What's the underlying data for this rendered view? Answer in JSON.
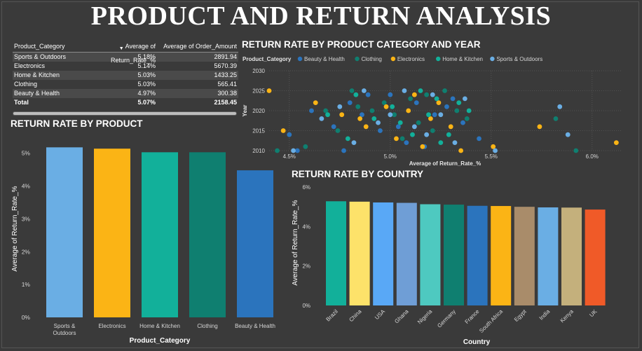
{
  "page": {
    "title": "PRODUCT AND RETURN ANALYSIS"
  },
  "table": {
    "headers": [
      "Product_Category",
      "Average of Return_Rate_%",
      "Average of Order_Amount"
    ],
    "rows": [
      [
        "Sports & Outdoors",
        "5.18%",
        "2891.94"
      ],
      [
        "Electronics",
        "5.14%",
        "5670.39"
      ],
      [
        "Home & Kitchen",
        "5.03%",
        "1433.25"
      ],
      [
        "Clothing",
        "5.03%",
        "565.41"
      ],
      [
        "Beauty & Health",
        "4.97%",
        "300.38"
      ]
    ],
    "total": [
      "Total",
      "5.07%",
      "2158.45"
    ]
  },
  "colors": {
    "Sports & Outdoors": "#6aaee4",
    "Electronics": "#fbb415",
    "Home & Kitchen": "#12b09a",
    "Clothing": "#0f7f70",
    "Beauty & Health": "#2b74bd"
  },
  "chart_data": [
    {
      "type": "bar",
      "title": "RETURN RATE BY PRODUCT",
      "xlabel": "Product_Category",
      "ylabel": "Average of Return_Rate_%",
      "categories": [
        "Sports & Outdoors",
        "Electronics",
        "Home & Kitchen",
        "Clothing",
        "Beauty & Health"
      ],
      "category_labels": [
        [
          "Sports &",
          "Outdoors"
        ],
        [
          "Electronics"
        ],
        [
          "Home & Kitchen"
        ],
        [
          "Clothing"
        ],
        [
          "Beauty & Health"
        ]
      ],
      "values": [
        5.18,
        5.14,
        5.03,
        5.03,
        4.48
      ],
      "ylim": [
        0,
        5.4
      ],
      "yticks": [
        0,
        1,
        2,
        3,
        4,
        5
      ],
      "ytick_labels": [
        "0%",
        "1%",
        "2%",
        "3%",
        "4%",
        "5%"
      ],
      "bar_colors": [
        "#6aaee4",
        "#fbb415",
        "#12b09a",
        "#0f7f70",
        "#2b74bd"
      ],
      "grid": false
    },
    {
      "type": "scatter",
      "title": "RETURN RATE BY PRODUCT CATEGORY AND YEAR",
      "xlabel": "Average of Return_Rate_%",
      "ylabel": "Year",
      "legend_title": "Product_Category",
      "legend_position": "top",
      "xlim": [
        4.4,
        6.15
      ],
      "ylim": [
        2010,
        2030
      ],
      "xticks": [
        4.5,
        5.0,
        5.5,
        6.0
      ],
      "xtick_labels": [
        "4.5%",
        "5.0%",
        "5.5%",
        "6.0%"
      ],
      "yticks": [
        2010,
        2015,
        2020,
        2025,
        2030
      ],
      "ytick_labels": [
        "2010",
        "2015",
        "2020",
        "2025",
        "2030"
      ],
      "grid": true,
      "series": [
        {
          "name": "Beauty & Health",
          "color": "#2b74bd",
          "points": [
            [
              4.5,
              2014
            ],
            [
              4.54,
              2010
            ],
            [
              4.61,
              2020
            ],
            [
              4.72,
              2016
            ],
            [
              4.77,
              2010
            ],
            [
              4.8,
              2022
            ],
            [
              4.86,
              2019
            ],
            [
              4.89,
              2024
            ],
            [
              4.95,
              2015
            ],
            [
              5.0,
              2024
            ],
            [
              5.04,
              2016
            ],
            [
              5.08,
              2012
            ],
            [
              5.13,
              2022
            ],
            [
              5.17,
              2011
            ],
            [
              5.22,
              2019
            ],
            [
              5.28,
              2021
            ],
            [
              5.31,
              2023
            ],
            [
              5.36,
              2017
            ],
            [
              5.44,
              2013
            ]
          ]
        },
        {
          "name": "Clothing",
          "color": "#0f7f70",
          "points": [
            [
              4.44,
              2010
            ],
            [
              4.58,
              2011
            ],
            [
              4.68,
              2020
            ],
            [
              4.74,
              2015
            ],
            [
              4.81,
              2025
            ],
            [
              4.84,
              2021
            ],
            [
              4.91,
              2020
            ],
            [
              4.97,
              2022
            ],
            [
              5.02,
              2019
            ],
            [
              5.06,
              2013
            ],
            [
              5.1,
              2023
            ],
            [
              5.14,
              2017
            ],
            [
              5.18,
              2024
            ],
            [
              5.21,
              2015
            ],
            [
              5.27,
              2025
            ],
            [
              5.33,
              2020
            ],
            [
              5.38,
              2018
            ],
            [
              5.82,
              2018
            ],
            [
              5.92,
              2010
            ]
          ]
        },
        {
          "name": "Electronics",
          "color": "#fbb415",
          "points": [
            [
              4.4,
              2025
            ],
            [
              4.47,
              2015
            ],
            [
              4.63,
              2022
            ],
            [
              4.76,
              2019
            ],
            [
              4.85,
              2018
            ],
            [
              4.88,
              2016
            ],
            [
              4.98,
              2021
            ],
            [
              5.03,
              2013
            ],
            [
              5.09,
              2020
            ],
            [
              5.12,
              2024
            ],
            [
              5.16,
              2011
            ],
            [
              5.2,
              2018
            ],
            [
              5.24,
              2022
            ],
            [
              5.3,
              2016
            ],
            [
              5.35,
              2010
            ],
            [
              5.51,
              2011
            ],
            [
              5.74,
              2016
            ],
            [
              6.12,
              2012
            ]
          ]
        },
        {
          "name": "Home & Kitchen",
          "color": "#12b09a",
          "points": [
            [
              4.69,
              2019
            ],
            [
              4.79,
              2013
            ],
            [
              4.83,
              2024
            ],
            [
              4.92,
              2018
            ],
            [
              5.01,
              2021
            ],
            [
              5.05,
              2017
            ],
            [
              5.11,
              2014
            ],
            [
              5.15,
              2025
            ],
            [
              5.19,
              2019
            ],
            [
              5.23,
              2023
            ],
            [
              5.25,
              2012
            ],
            [
              5.29,
              2014
            ],
            [
              5.34,
              2022
            ],
            [
              5.39,
              2020
            ]
          ]
        },
        {
          "name": "Sports & Outdoors",
          "color": "#6aaee4",
          "points": [
            [
              4.52,
              2010
            ],
            [
              4.66,
              2018
            ],
            [
              4.75,
              2021
            ],
            [
              4.82,
              2012
            ],
            [
              4.87,
              2025
            ],
            [
              4.94,
              2017
            ],
            [
              5.0,
              2019
            ],
            [
              5.07,
              2025
            ],
            [
              5.12,
              2016
            ],
            [
              5.18,
              2014
            ],
            [
              5.21,
              2024
            ],
            [
              5.25,
              2019
            ],
            [
              5.32,
              2012
            ],
            [
              5.37,
              2023
            ],
            [
              5.52,
              2010
            ],
            [
              5.84,
              2021
            ],
            [
              5.88,
              2014
            ]
          ]
        }
      ]
    },
    {
      "type": "bar",
      "title": "RETURN RATE BY COUNTRY",
      "xlabel": "Country",
      "ylabel": "Average of Return_Rate_%",
      "categories": [
        "Brazil",
        "China",
        "USA",
        "Ghana",
        "Nigeria",
        "Germany",
        "France",
        "South Africa",
        "Egypt",
        "India",
        "Kenya",
        "UK"
      ],
      "values": [
        5.28,
        5.26,
        5.22,
        5.2,
        5.13,
        5.11,
        5.05,
        5.04,
        5.0,
        4.97,
        4.96,
        4.86
      ],
      "ylim": [
        0,
        6
      ],
      "yticks": [
        0,
        2,
        4,
        6
      ],
      "ytick_labels": [
        "0%",
        "2%",
        "4%",
        "6%"
      ],
      "bar_colors": [
        "#12b09a",
        "#fde26a",
        "#59a8f6",
        "#6f9ed6",
        "#4ec9c0",
        "#0f7f70",
        "#2b74bd",
        "#fbb415",
        "#a98c6a",
        "#6aaee4",
        "#c4b07c",
        "#f05a28"
      ],
      "grid": false
    }
  ]
}
